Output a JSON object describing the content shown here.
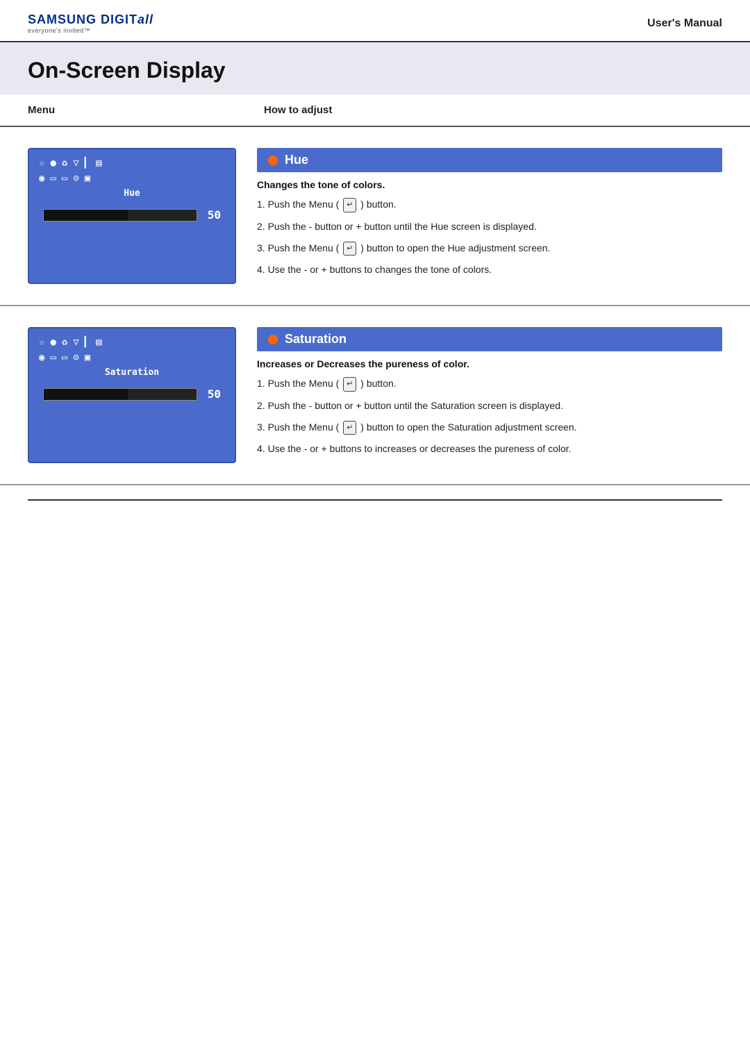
{
  "header": {
    "logo_main": "SAMSUNG DIGIT",
    "logo_italic": "all",
    "logo_sub": "everyone's invited™",
    "manual_title": "User's Manual"
  },
  "page_title": "On-Screen Display",
  "columns": {
    "menu_label": "Menu",
    "how_label": "How to adjust"
  },
  "sections": [
    {
      "id": "hue",
      "osd_label": "Hue",
      "bar_value": "50",
      "title": "Hue",
      "subtitle": "Changes the tone of colors.",
      "instructions": [
        "1. Push the Menu (↵) button.",
        "2. Push the - button or + button until the Hue screen is displayed.",
        "3. Push the Menu (↵) button to open the Hue adjustment screen.",
        "4. Use the - or + buttons to changes the tone of colors."
      ]
    },
    {
      "id": "saturation",
      "osd_label": "Saturation",
      "bar_value": "50",
      "title": "Saturation",
      "subtitle": "Increases or Decreases the pureness of color.",
      "instructions": [
        "1. Push the Menu (↵) button.",
        "2. Push the - button or + button until the Saturation screen is displayed.",
        "3. Push the Menu (↵) button to open the Saturation adjustment screen.",
        "4. Use the - or + buttons to increases or decreases the pureness of color."
      ]
    }
  ],
  "icons_row1": [
    "☆",
    "●",
    "♻",
    "▽",
    "▎",
    "▤"
  ],
  "icons_row2": [
    "◉",
    "▭",
    "▭",
    "⊙",
    "▣"
  ],
  "bar_fill_percent": "55%"
}
